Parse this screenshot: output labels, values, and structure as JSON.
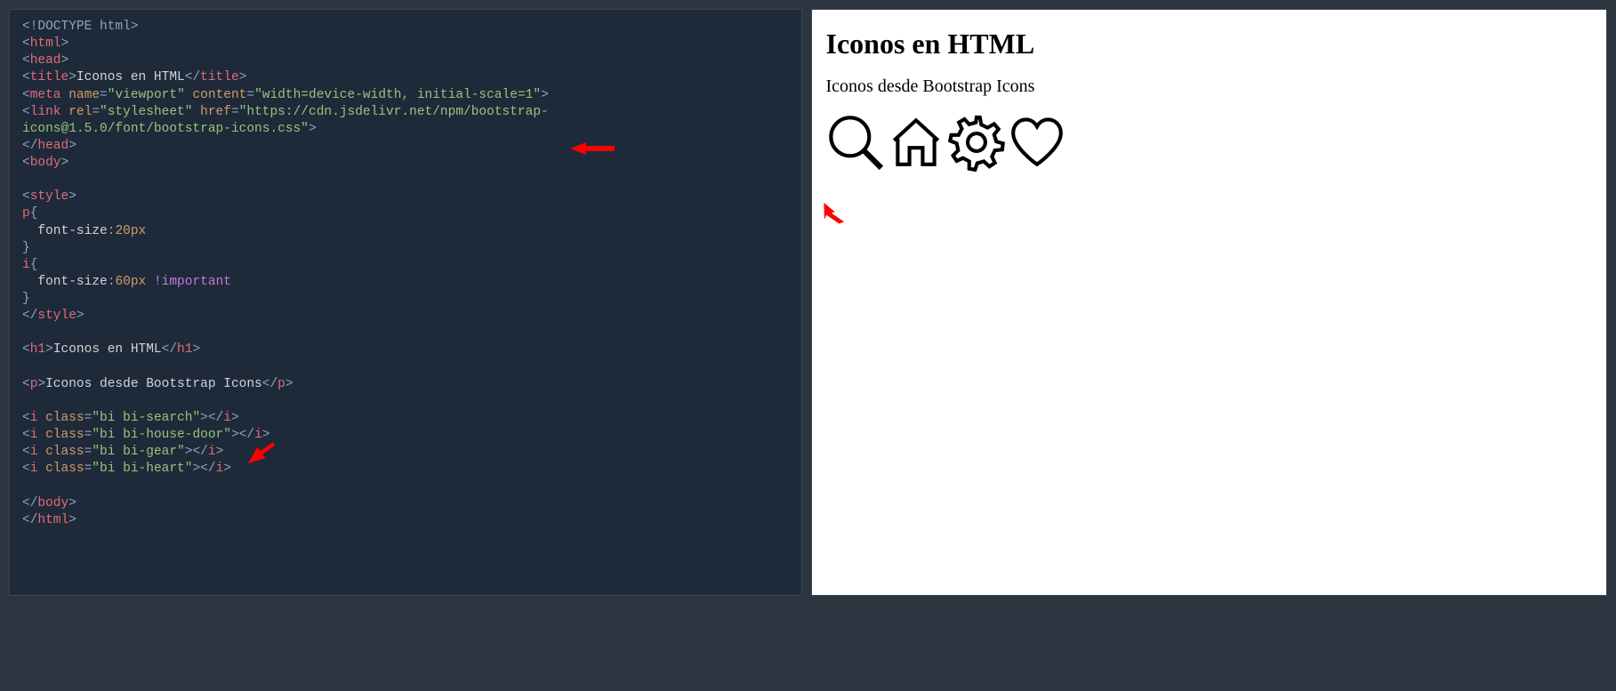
{
  "code": {
    "doctype": "<!DOCTYPE html>",
    "html_open": "html",
    "head_open": "head",
    "title_tag": "title",
    "title_text": "Iconos en HTML",
    "meta_tag": "meta",
    "meta_name_attr": "name",
    "meta_name_val": "viewport",
    "meta_content_attr": "content",
    "meta_content_val": "width=device-width, initial-scale=1",
    "link_tag": "link",
    "link_rel_attr": "rel",
    "link_rel_val": "stylesheet",
    "link_href_attr": "href",
    "link_href_val1": "https://cdn.jsdelivr.net/npm/bootstrap-",
    "link_href_val2": "icons@1.5.0/font/bootstrap-icons.css",
    "head_close": "head",
    "body_open": "body",
    "style_open": "style",
    "p_sel": "p",
    "brace_open": "{",
    "font_size_prop": "font-size",
    "p_size_val": "20px",
    "brace_close": "}",
    "i_sel": "i",
    "i_size_val": "60px",
    "important": "!important",
    "style_close": "style",
    "h1_tag": "h1",
    "h1_text": "Iconos en HTML",
    "p_tag": "p",
    "p_text": "Iconos desde Bootstrap Icons",
    "i_tag": "i",
    "class_attr": "class",
    "i1_class": "bi bi-search",
    "i2_class": "bi bi-house-door",
    "i3_class": "bi bi-gear",
    "i4_class": "bi bi-heart",
    "body_close": "body",
    "html_close": "html"
  },
  "preview": {
    "heading": "Iconos en HTML",
    "subtext": "Iconos desde Bootstrap Icons"
  }
}
